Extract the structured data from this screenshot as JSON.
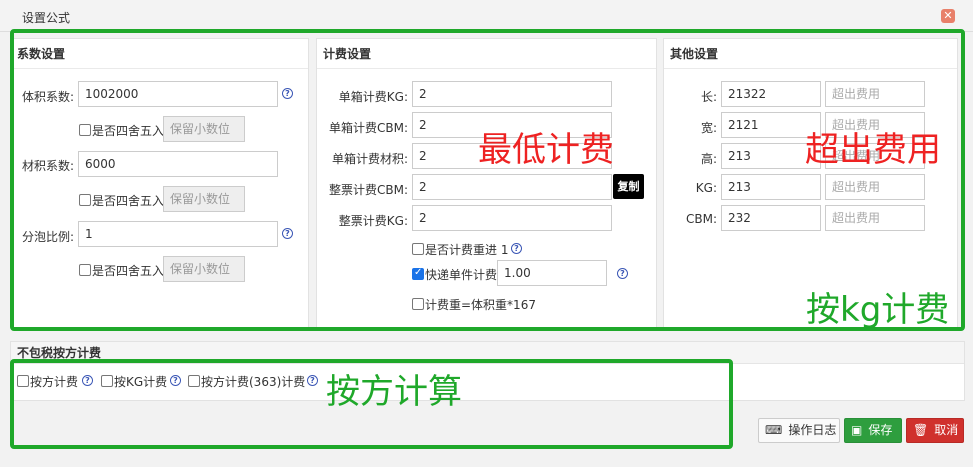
{
  "dialog": {
    "title": "设置公式",
    "close_glyph": "✕"
  },
  "coef": {
    "header": "系数设置",
    "volume_label": "体积系数:",
    "volume_value": "1002000",
    "material_label": "材积系数:",
    "material_value": "6000",
    "split_label": "分泡比例:",
    "split_value": "1",
    "round_label": "是否四舍五入",
    "decimal_placeholder": "保留小数位"
  },
  "fee": {
    "header": "计费设置",
    "rows": [
      {
        "label": "单箱计费KG:",
        "value": "2"
      },
      {
        "label": "单箱计费CBM:",
        "value": "2"
      },
      {
        "label": "单箱计费材积:",
        "value": "2"
      },
      {
        "label": "整票计费CBM:",
        "value": "2"
      },
      {
        "label": "整票计费KG:",
        "value": "2"
      }
    ],
    "copy_label": "复制",
    "heavy_label": "是否计费重进 1",
    "express_label": "快递单件计费",
    "express_value": "1.00",
    "formula_label": "计费重=体积重*167"
  },
  "other": {
    "header": "其他设置",
    "rows": [
      {
        "label": "长:",
        "value": "21322"
      },
      {
        "label": "宽:",
        "value": "2121"
      },
      {
        "label": "高:",
        "value": "213"
      },
      {
        "label": "KG:",
        "value": "213"
      },
      {
        "label": "CBM:",
        "value": "232"
      }
    ],
    "extra_placeholder": "超出费用"
  },
  "bottom": {
    "header": "不包税按方计费",
    "opt1": "按方计费",
    "opt2": "按KG计费",
    "opt3": "按方计费(363)计费"
  },
  "annotations": {
    "min_fee": "最低计费",
    "extra_fee": "超出费用",
    "by_kg": "按kg计费",
    "by_cbm": "按方计算"
  },
  "buttons": {
    "log": "操作日志",
    "save": "保存",
    "cancel": "取消"
  }
}
